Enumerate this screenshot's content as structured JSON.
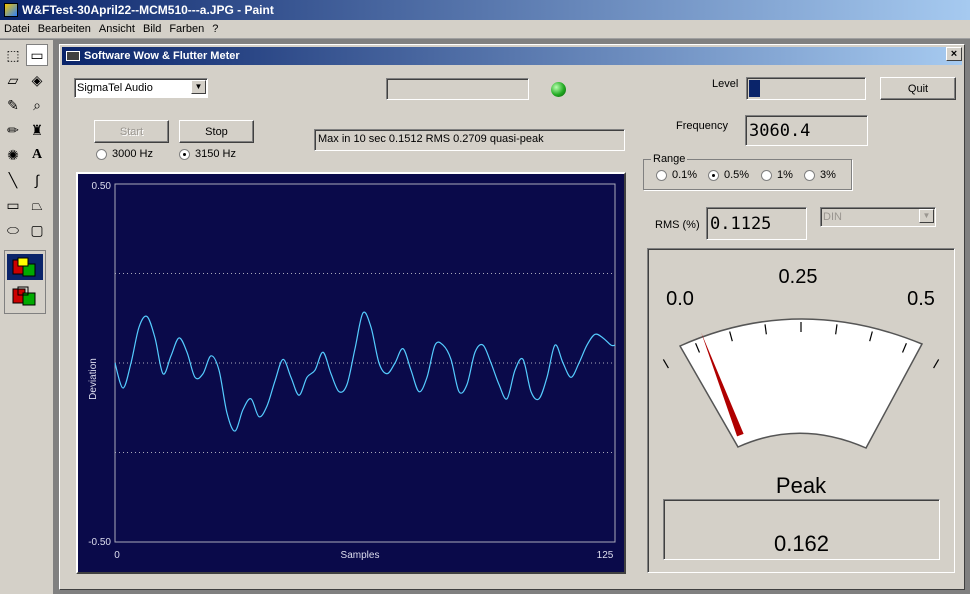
{
  "paint": {
    "title": "W&FTest-30April22--MCM510---a.JPG - Paint",
    "menu": [
      "Datei",
      "Bearbeiten",
      "Ansicht",
      "Bild",
      "Farben",
      "?"
    ],
    "tools": [
      "free-select-icon",
      "rect-select-icon",
      "eraser-icon",
      "fill-icon",
      "color-picker-icon",
      "magnifier-icon",
      "pencil-icon",
      "brush-icon",
      "airbrush-icon",
      "text-icon",
      "line-icon",
      "curve-icon",
      "rectangle-icon",
      "polygon-icon",
      "ellipse-icon",
      "rounded-rect-icon"
    ]
  },
  "app": {
    "title": "Software Wow & Flutter Meter",
    "close_label": "×",
    "device": "SigmaTel Audio",
    "start_label": "Start",
    "stop_label": "Stop",
    "freq_options": [
      {
        "label": "3000 Hz",
        "selected": false
      },
      {
        "label": "3150 Hz",
        "selected": true
      }
    ],
    "status_text": "Max in 10 sec 0.1512 RMS 0.2709 quasi-peak",
    "level_label": "Level",
    "level_fraction": 0.1,
    "quit_label": "Quit",
    "frequency_label": "Frequency",
    "frequency_value": "3060.4",
    "range_label": "Range",
    "range_options": [
      {
        "label": "0.1%",
        "selected": false
      },
      {
        "label": "0.5%",
        "selected": true
      },
      {
        "label": "1%",
        "selected": false
      },
      {
        "label": "3%",
        "selected": false
      }
    ],
    "rms_label": "RMS (%)",
    "rms_value": "0.1125",
    "weighting": "DIN",
    "meter": {
      "scale_left": "0.0",
      "scale_mid": "0.25",
      "scale_right": "0.5",
      "needle_value": 0.1125,
      "scale_max": 0.5,
      "peak_label": "Peak",
      "peak_value": "0.162"
    },
    "indicator_color": "#22aa22"
  },
  "chart_data": {
    "type": "line",
    "ylabel": "Deviation",
    "xlabel": "Samples",
    "xlim": [
      0,
      125
    ],
    "ylim": [
      -0.5,
      0.5
    ],
    "x_ticks": [
      "0",
      "125"
    ],
    "y_ticks": [
      "0.50",
      "-0.50"
    ],
    "grid_y": [
      0.25,
      0.0,
      -0.25
    ],
    "series": [
      {
        "color": "#55ccff",
        "x": [
          0,
          2,
          4,
          6,
          8,
          10,
          12,
          14,
          16,
          18,
          20,
          22,
          24,
          26,
          28,
          30,
          32,
          34,
          36,
          38,
          40,
          42,
          44,
          46,
          48,
          50,
          52,
          54,
          56,
          58,
          60,
          62,
          64,
          66,
          68,
          70,
          72,
          74,
          76,
          78,
          80,
          82,
          84,
          86,
          88,
          90,
          92,
          94,
          96,
          98,
          100,
          102,
          104,
          106,
          108,
          110,
          112,
          114,
          116,
          118,
          120,
          122,
          124,
          125
        ],
        "y": [
          0.0,
          -0.07,
          0.0,
          0.1,
          0.13,
          0.07,
          -0.03,
          0.02,
          0.07,
          0.03,
          -0.04,
          -0.03,
          0.02,
          -0.02,
          -0.14,
          -0.19,
          -0.13,
          -0.1,
          -0.15,
          -0.12,
          -0.05,
          0.01,
          -0.04,
          -0.09,
          -0.04,
          -0.02,
          0.03,
          -0.03,
          -0.08,
          -0.06,
          0.04,
          0.14,
          0.1,
          0.0,
          -0.03,
          0.0,
          0.04,
          -0.02,
          -0.08,
          -0.04,
          0.05,
          0.05,
          0.01,
          -0.08,
          -0.06,
          0.03,
          0.05,
          0.0,
          -0.06,
          -0.1,
          -0.02,
          0.01,
          -0.08,
          -0.1,
          -0.04,
          0.05,
          0.0,
          -0.04,
          0.0,
          0.05,
          0.08,
          0.07,
          0.05,
          0.05
        ]
      }
    ]
  }
}
